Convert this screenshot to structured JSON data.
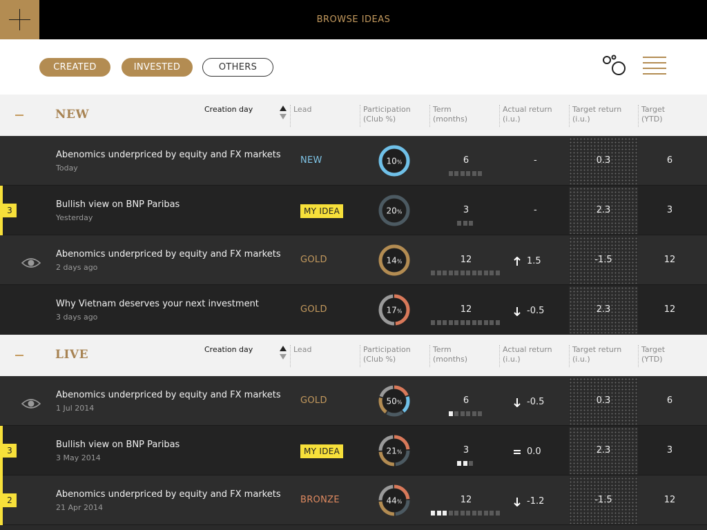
{
  "header": {
    "title": "BROWSE IDEAS"
  },
  "filters": [
    {
      "label": "CREATED",
      "active": true
    },
    {
      "label": "INVESTED",
      "active": true
    },
    {
      "label": "OTHERS",
      "active": false
    }
  ],
  "columns": {
    "sort": "Creation day",
    "lead": "Lead",
    "participation": [
      "Participation",
      "(Club %)"
    ],
    "term": [
      "Term",
      "(months)"
    ],
    "actual": [
      "Actual return",
      "(i.u.)"
    ],
    "target": [
      "Target return",
      "(i.u.)"
    ],
    "ytd": [
      "Target",
      "(YTD)"
    ]
  },
  "colors": {
    "gold": "#c49a5e",
    "new": "#7fc4e6",
    "bronze": "#e08a60",
    "badge": "#f7e03a"
  },
  "sections": [
    {
      "title": "NEW",
      "rows": [
        {
          "title": "Abenomics underpriced by equity and FX markets",
          "date": "Today",
          "lead": "NEW",
          "lead_style": "new",
          "participation": "10",
          "donut_colors": [
            "#6fc0e8"
          ],
          "term": "6",
          "term_total": 6,
          "term_filled": 0,
          "actual": "-",
          "actual_arrow": "none",
          "target": "0.3",
          "ytd": "6",
          "rank": "",
          "eye": false,
          "pattern": true
        },
        {
          "title": "Bullish view on BNP Paribas",
          "date": "Yesterday",
          "lead": "MY IDEA",
          "lead_style": "badge",
          "participation": "20",
          "donut_colors": [
            "#4c5a62"
          ],
          "term": "3",
          "term_total": 3,
          "term_filled": 0,
          "actual": "-",
          "actual_arrow": "none",
          "target": "2.3",
          "ytd": "3",
          "rank": "3",
          "eye": false,
          "pattern": true
        },
        {
          "title": "Abenomics underpriced by equity and FX markets",
          "date": "2 days ago",
          "lead": "GOLD",
          "lead_style": "gold",
          "participation": "14",
          "donut_colors": [
            "#b38c52"
          ],
          "term": "12",
          "term_total": 12,
          "term_filled": 0,
          "actual": "1.5",
          "actual_arrow": "up",
          "target": "-1.5",
          "ytd": "12",
          "rank": "",
          "eye": true,
          "pattern": true
        },
        {
          "title": "Why Vietnam deserves your next investment",
          "date": "3 days ago",
          "lead": "GOLD",
          "lead_style": "gold",
          "participation": "17",
          "donut_colors": [
            "#d9795a",
            "#9a9a9a"
          ],
          "term": "12",
          "term_total": 12,
          "term_filled": 0,
          "actual": "-0.5",
          "actual_arrow": "down",
          "target": "2.3",
          "ytd": "12",
          "rank": "",
          "eye": false,
          "pattern": true
        }
      ]
    },
    {
      "title": "LIVE",
      "rows": [
        {
          "title": "Abenomics underpriced by equity and FX markets",
          "date": "1 Jul 2014",
          "lead": "GOLD",
          "lead_style": "gold",
          "participation": "50",
          "donut_colors": [
            "#d9795a",
            "#6fc0e8",
            "#4c5a62",
            "#b38c52",
            "#9a9a9a"
          ],
          "term": "6",
          "term_total": 6,
          "term_filled": 1,
          "actual": "-0.5",
          "actual_arrow": "down",
          "target": "0.3",
          "ytd": "6",
          "rank": "",
          "eye": true,
          "pattern": true
        },
        {
          "title": "Bullish view on BNP Paribas",
          "date": "3 May 2014",
          "lead": "MY IDEA",
          "lead_style": "badge",
          "participation": "21",
          "donut_colors": [
            "#d9795a",
            "#4c5a62",
            "#b38c52",
            "#9a9a9a"
          ],
          "term": "3",
          "term_total": 3,
          "term_filled": 2,
          "actual": "0.0",
          "actual_arrow": "equal",
          "target": "2.3",
          "ytd": "3",
          "rank": "3",
          "eye": false,
          "pattern": true
        },
        {
          "title": "Abenomics underpriced by equity and FX markets",
          "date": "21 Apr 2014",
          "lead": "BRONZE",
          "lead_style": "bronze",
          "participation": "44",
          "donut_colors": [
            "#d9795a",
            "#4c5a62",
            "#b38c52",
            "#9a9a9a"
          ],
          "term": "12",
          "term_total": 12,
          "term_filled": 3,
          "actual": "-1.2",
          "actual_arrow": "down",
          "target": "-1.5",
          "ytd": "12",
          "rank": "2",
          "eye": false,
          "pattern": true
        }
      ]
    }
  ]
}
